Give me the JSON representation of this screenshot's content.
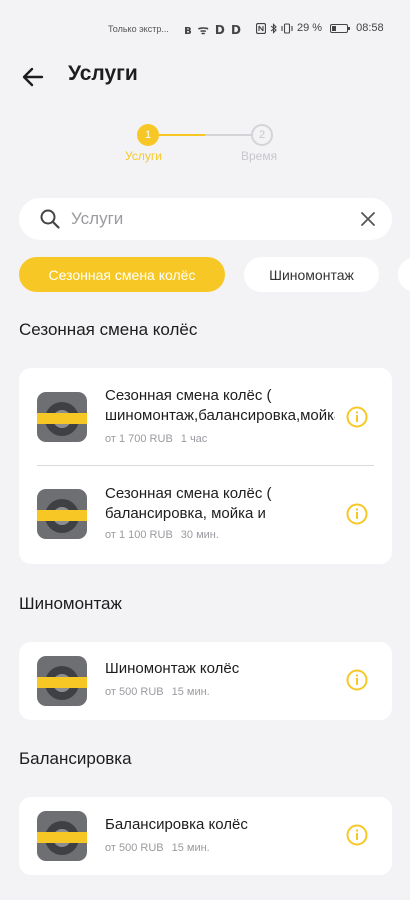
{
  "status_bar": {
    "carrier": "Только экстр...",
    "icons": "ʙ ᯤ D D",
    "battery_percent": "29 %",
    "time": "08:58",
    "battery_level": 0.29
  },
  "header": {
    "title": "Услуги"
  },
  "stepper": {
    "steps": [
      {
        "number": "1",
        "label": "Услуги",
        "active": true
      },
      {
        "number": "2",
        "label": "Время",
        "active": false
      }
    ]
  },
  "search": {
    "placeholder": "Услуги",
    "value": ""
  },
  "categories": [
    {
      "label": "Сезонная смена колёс",
      "selected": true
    },
    {
      "label": "Шиномонтаж",
      "selected": false
    }
  ],
  "sections": [
    {
      "title": "Сезонная смена колёс",
      "items": [
        {
          "name": "Сезонная смена колёс ( шиномонтаж,балансировка,мойка",
          "price": "от 1 700 RUB",
          "duration": "1 час"
        },
        {
          "name": "Сезонная смена колёс ( балансировка, мойка и",
          "price": "от 1 100 RUB",
          "duration": "30 мин."
        }
      ]
    },
    {
      "title": "Шиномонтаж",
      "items": [
        {
          "name": "Шиномонтаж колёс",
          "price": "от 500 RUB",
          "duration": "15 мин."
        }
      ]
    },
    {
      "title": "Балансировка",
      "items": [
        {
          "name": "Балансировка колёс",
          "price": "от 500 RUB",
          "duration": "15 мин."
        }
      ]
    }
  ],
  "colors": {
    "accent": "#f7c825",
    "background": "#f3f3f6",
    "card": "#ffffff"
  },
  "icons": [
    "back-arrow-icon",
    "search-icon",
    "close-icon",
    "info-icon",
    "tire-thumbnail"
  ]
}
